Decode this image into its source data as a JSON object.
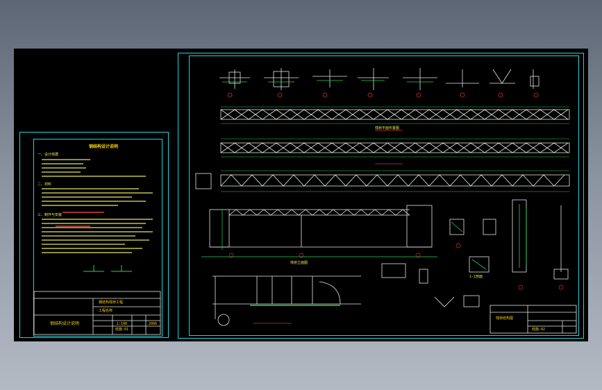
{
  "notes_sheet": {
    "title": "钢结构设计说明",
    "heading_1": "一、设计依据",
    "heading_2": "二、材料",
    "heading_3": "三、制作与安装",
    "title_block": {
      "project": "钢结构栈桥工程",
      "drawing_name": "钢结构设计说明",
      "sub_title": "工程名称",
      "scale": "1:100",
      "sheet_no": "结施-01",
      "date": "2006"
    }
  },
  "main_sheet": {
    "plan_label": "栈桥平面布置图",
    "elevation_label": "栈桥立面图",
    "section_label": "1-1剖面",
    "title_block": {
      "title": "栈桥结构图",
      "sheet_no": "结施-02"
    }
  },
  "colors": {
    "frame": "#1fd6e0",
    "truss": "#e8e8e8",
    "green": "#27d84a",
    "yellow": "#f5d400",
    "red": "#e02a2a"
  }
}
